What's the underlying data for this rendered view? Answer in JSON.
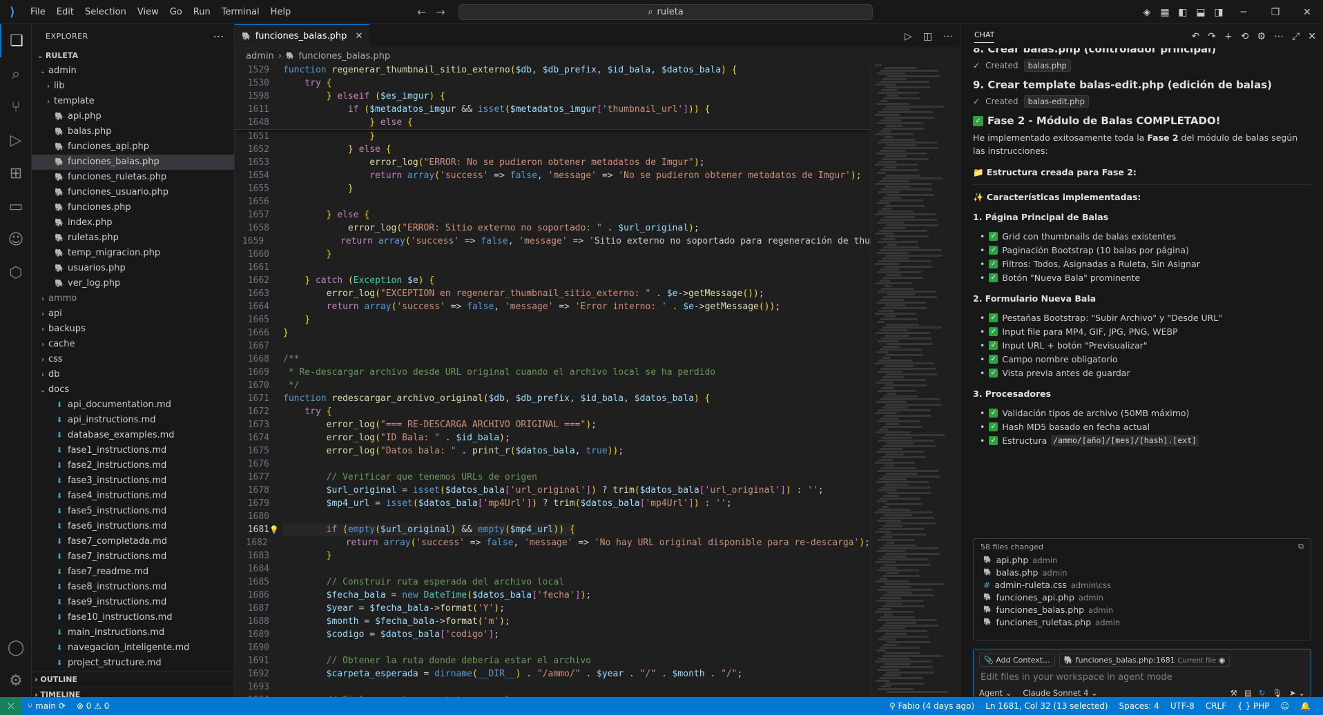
{
  "menu": [
    "File",
    "Edit",
    "Selection",
    "View",
    "Go",
    "Run",
    "Terminal",
    "Help"
  ],
  "search": {
    "text": "ruleta"
  },
  "explorer": {
    "title": "EXPLORER",
    "root": "RULETA",
    "items": [
      {
        "label": "admin",
        "type": "folder-open",
        "indent": 1
      },
      {
        "label": "lib",
        "type": "folder",
        "indent": 2
      },
      {
        "label": "template",
        "type": "folder",
        "indent": 2
      },
      {
        "label": "api.php",
        "type": "php",
        "indent": 2
      },
      {
        "label": "balas.php",
        "type": "php",
        "indent": 2
      },
      {
        "label": "funciones_api.php",
        "type": "php",
        "indent": 2
      },
      {
        "label": "funciones_balas.php",
        "type": "php",
        "indent": 2,
        "selected": true
      },
      {
        "label": "funciones_ruletas.php",
        "type": "php",
        "indent": 2
      },
      {
        "label": "funciones_usuario.php",
        "type": "php",
        "indent": 2
      },
      {
        "label": "funciones.php",
        "type": "php",
        "indent": 2
      },
      {
        "label": "index.php",
        "type": "php",
        "indent": 2
      },
      {
        "label": "ruletas.php",
        "type": "php",
        "indent": 2
      },
      {
        "label": "temp_migracion.php",
        "type": "php",
        "indent": 2
      },
      {
        "label": "usuarios.php",
        "type": "php",
        "indent": 2
      },
      {
        "label": "ver_log.php",
        "type": "php",
        "indent": 2
      },
      {
        "label": "ammo",
        "type": "folder-dim",
        "indent": 1
      },
      {
        "label": "api",
        "type": "folder",
        "indent": 1
      },
      {
        "label": "backups",
        "type": "folder",
        "indent": 1
      },
      {
        "label": "cache",
        "type": "folder",
        "indent": 1
      },
      {
        "label": "css",
        "type": "folder",
        "indent": 1
      },
      {
        "label": "db",
        "type": "folder",
        "indent": 1
      },
      {
        "label": "docs",
        "type": "folder-open",
        "indent": 1
      },
      {
        "label": "api_documentation.md",
        "type": "md",
        "indent": 2
      },
      {
        "label": "api_instructions.md",
        "type": "md",
        "indent": 2
      },
      {
        "label": "database_examples.md",
        "type": "md",
        "indent": 2
      },
      {
        "label": "fase1_instructions.md",
        "type": "md",
        "indent": 2
      },
      {
        "label": "fase2_instructions.md",
        "type": "md",
        "indent": 2
      },
      {
        "label": "fase3_instructions.md",
        "type": "md",
        "indent": 2
      },
      {
        "label": "fase4_instructions.md",
        "type": "md",
        "indent": 2
      },
      {
        "label": "fase5_instructions.md",
        "type": "md",
        "indent": 2
      },
      {
        "label": "fase6_instructions.md",
        "type": "md",
        "indent": 2
      },
      {
        "label": "fase7_completada.md",
        "type": "md",
        "indent": 2
      },
      {
        "label": "fase7_instructions.md",
        "type": "md",
        "indent": 2
      },
      {
        "label": "fase7_readme.md",
        "type": "md",
        "indent": 2
      },
      {
        "label": "fase8_instructions.md",
        "type": "md",
        "indent": 2
      },
      {
        "label": "fase9_instructions.md",
        "type": "md",
        "indent": 2
      },
      {
        "label": "fase10_instructions.md",
        "type": "md",
        "indent": 2
      },
      {
        "label": "main_instructions.md",
        "type": "md",
        "indent": 2
      },
      {
        "label": "navegacion_inteligente.md",
        "type": "md",
        "indent": 2
      },
      {
        "label": "project_structure.md",
        "type": "md",
        "indent": 2
      }
    ],
    "outline": "OUTLINE",
    "timeline": "TIMELINE"
  },
  "editor": {
    "tab_label": "funciones_balas.php",
    "breadcrumb": [
      "admin",
      "funciones_balas.php"
    ],
    "current_line": "1681",
    "sticky_lines": [
      {
        "n": "1529",
        "t": "function regenerar_thumbnail_sitio_externo($db, $db_prefix, $id_bala, $datos_bala) {"
      },
      {
        "n": "1530",
        "t": "    try {"
      },
      {
        "n": "1598",
        "t": "        } elseif ($es_imgur) {"
      },
      {
        "n": "1611",
        "t": "            if ($metadatos_imgur && isset($metadatos_imgur['thumbnail_url'])) {"
      },
      {
        "n": "1648",
        "t": "                } else {"
      }
    ],
    "lines": [
      {
        "n": "1651",
        "t": "                }"
      },
      {
        "n": "1652",
        "t": "            } else {"
      },
      {
        "n": "1653",
        "t": "                error_log(\"ERROR: No se pudieron obtener metadatos de Imgur\");"
      },
      {
        "n": "1654",
        "t": "                return array('success' => false, 'message' => 'No se pudieron obtener metadatos de Imgur');"
      },
      {
        "n": "1655",
        "t": "            }"
      },
      {
        "n": "1656",
        "t": ""
      },
      {
        "n": "1657",
        "t": "        } else {"
      },
      {
        "n": "1658",
        "t": "            error_log(\"ERROR: Sitio externo no soportado: \" . $url_original);"
      },
      {
        "n": "1659",
        "t": "            return array('success' => false, 'message' => 'Sitio externo no soportado para regeneración de thu"
      },
      {
        "n": "1660",
        "t": "        }"
      },
      {
        "n": "1661",
        "t": ""
      },
      {
        "n": "1662",
        "t": "    } catch (Exception $e) {"
      },
      {
        "n": "1663",
        "t": "        error_log(\"EXCEPTION en regenerar_thumbnail_sitio_externo: \" . $e->getMessage());"
      },
      {
        "n": "1664",
        "t": "        return array('success' => false, 'message' => 'Error interno: ' . $e->getMessage());"
      },
      {
        "n": "1665",
        "t": "    }"
      },
      {
        "n": "1666",
        "t": "}"
      },
      {
        "n": "1667",
        "t": ""
      },
      {
        "n": "1668",
        "t": "/**"
      },
      {
        "n": "1669",
        "t": " * Re-descargar archivo desde URL original cuando el archivo local se ha perdido"
      },
      {
        "n": "1670",
        "t": " */"
      },
      {
        "n": "1671",
        "t": "function redescargar_archivo_original($db, $db_prefix, $id_bala, $datos_bala) {"
      },
      {
        "n": "1672",
        "t": "    try {"
      },
      {
        "n": "1673",
        "t": "        error_log(\"=== RE-DESCARGA ARCHIVO ORIGINAL ===\");"
      },
      {
        "n": "1674",
        "t": "        error_log(\"ID Bala: \" . $id_bala);"
      },
      {
        "n": "1675",
        "t": "        error_log(\"Datos bala: \" . print_r($datos_bala, true));"
      },
      {
        "n": "1676",
        "t": ""
      },
      {
        "n": "1677",
        "t": "        // Verificar que tenemos URLs de origen"
      },
      {
        "n": "1678",
        "t": "        $url_original = isset($datos_bala['url_original']) ? trim($datos_bala['url_original']) : '';"
      },
      {
        "n": "1679",
        "t": "        $mp4_url = isset($datos_bala['mp4Url']) ? trim($datos_bala['mp4Url']) : '';"
      },
      {
        "n": "1680",
        "t": ""
      },
      {
        "n": "1681",
        "t": "        if (empty($url_original) && empty($mp4_url)) {"
      },
      {
        "n": "1682",
        "t": "            return array('success' => false, 'message' => 'No hay URL original disponible para re-descarga');"
      },
      {
        "n": "1683",
        "t": "        }"
      },
      {
        "n": "1684",
        "t": ""
      },
      {
        "n": "1685",
        "t": "        // Construir ruta esperada del archivo local"
      },
      {
        "n": "1686",
        "t": "        $fecha_bala = new DateTime($datos_bala['fecha']);"
      },
      {
        "n": "1687",
        "t": "        $year = $fecha_bala->format('Y');"
      },
      {
        "n": "1688",
        "t": "        $month = $fecha_bala->format('m');"
      },
      {
        "n": "1689",
        "t": "        $codigo = $datos_bala['codigo'];"
      },
      {
        "n": "1690",
        "t": ""
      },
      {
        "n": "1691",
        "t": "        // Obtener la ruta donde debería estar el archivo"
      },
      {
        "n": "1692",
        "t": "        $carpeta_esperada = dirname(__DIR__) . \"/ammo/\" . $year . \"/\" . $month . \"/\";"
      },
      {
        "n": "1693",
        "t": ""
      },
      {
        "n": "1694",
        "t": "        // Si la carpeta no existe, crearla"
      }
    ]
  },
  "chat": {
    "title": "CHAT",
    "step8": "8. Crear balas.php (controlador principal)",
    "created_label": "Created",
    "step8_file": "balas.php",
    "step9": "9. Crear template balas-edit.php (edición de balas)",
    "step9_file": "balas-edit.php",
    "phase_done": "Fase 2 - Módulo de Balas COMPLETADO!",
    "intro_a": "He implementado exitosamente toda la ",
    "intro_b": "Fase 2",
    "intro_c": " del módulo de balas según las instrucciones:",
    "structure": "📁 Estructura creada para Fase 2:",
    "features": "✨ Características implementadas:",
    "sec1": "1. Página Principal de Balas",
    "sec1_items": [
      "Grid con thumbnails de balas existentes",
      "Paginación Bootstrap (10 balas por página)",
      "Filtros: Todos, Asignadas a Ruleta, Sin Asignar",
      "Botón \"Nueva Bala\" prominente"
    ],
    "sec2": "2. Formulario Nueva Bala",
    "sec2_items": [
      "Pestañas Bootstrap: \"Subir Archivo\" y \"Desde URL\"",
      "Input file para MP4, GIF, JPG, PNG, WEBP",
      "Input URL + botón \"Previsualizar\"",
      "Campo nombre obligatorio",
      "Vista previa antes de guardar"
    ],
    "sec3": "3. Procesadores",
    "sec3_items": [
      "Validación tipos de archivo (50MB máximo)",
      "Hash MD5 basado en fecha actual"
    ],
    "sec3_last_label": "Estructura",
    "sec3_last_code": "/ammo/[año]/[mes]/[hash].[ext]",
    "files_changed": "58 files changed",
    "files": [
      {
        "name": "api.php",
        "dir": "admin",
        "icon": "php"
      },
      {
        "name": "balas.php",
        "dir": "admin",
        "icon": "php"
      },
      {
        "name": "admin-ruleta.css",
        "dir": "admin\\css",
        "icon": "css"
      },
      {
        "name": "funciones_api.php",
        "dir": "admin",
        "icon": "php"
      },
      {
        "name": "funciones_balas.php",
        "dir": "admin",
        "icon": "php"
      },
      {
        "name": "funciones_ruletas.php",
        "dir": "admin",
        "icon": "php"
      }
    ],
    "add_context": "Add Context...",
    "context_file": "funciones_balas.php:1681",
    "context_tag": "Current file",
    "placeholder": "Edit files in your workspace in agent mode",
    "mode": "Agent",
    "model": "Claude Sonnet 4"
  },
  "status": {
    "branch": "main",
    "errors": "0",
    "warnings": "0",
    "blame": "Fabio (4 days ago)",
    "position": "Ln 1681, Col 32 (13 selected)",
    "spaces": "Spaces: 4",
    "encoding": "UTF-8",
    "eol": "CRLF",
    "language": "PHP"
  },
  "colors": {
    "accent": "#0078d4",
    "status_bg": "#0078d4",
    "remote_bg": "#16825d"
  }
}
